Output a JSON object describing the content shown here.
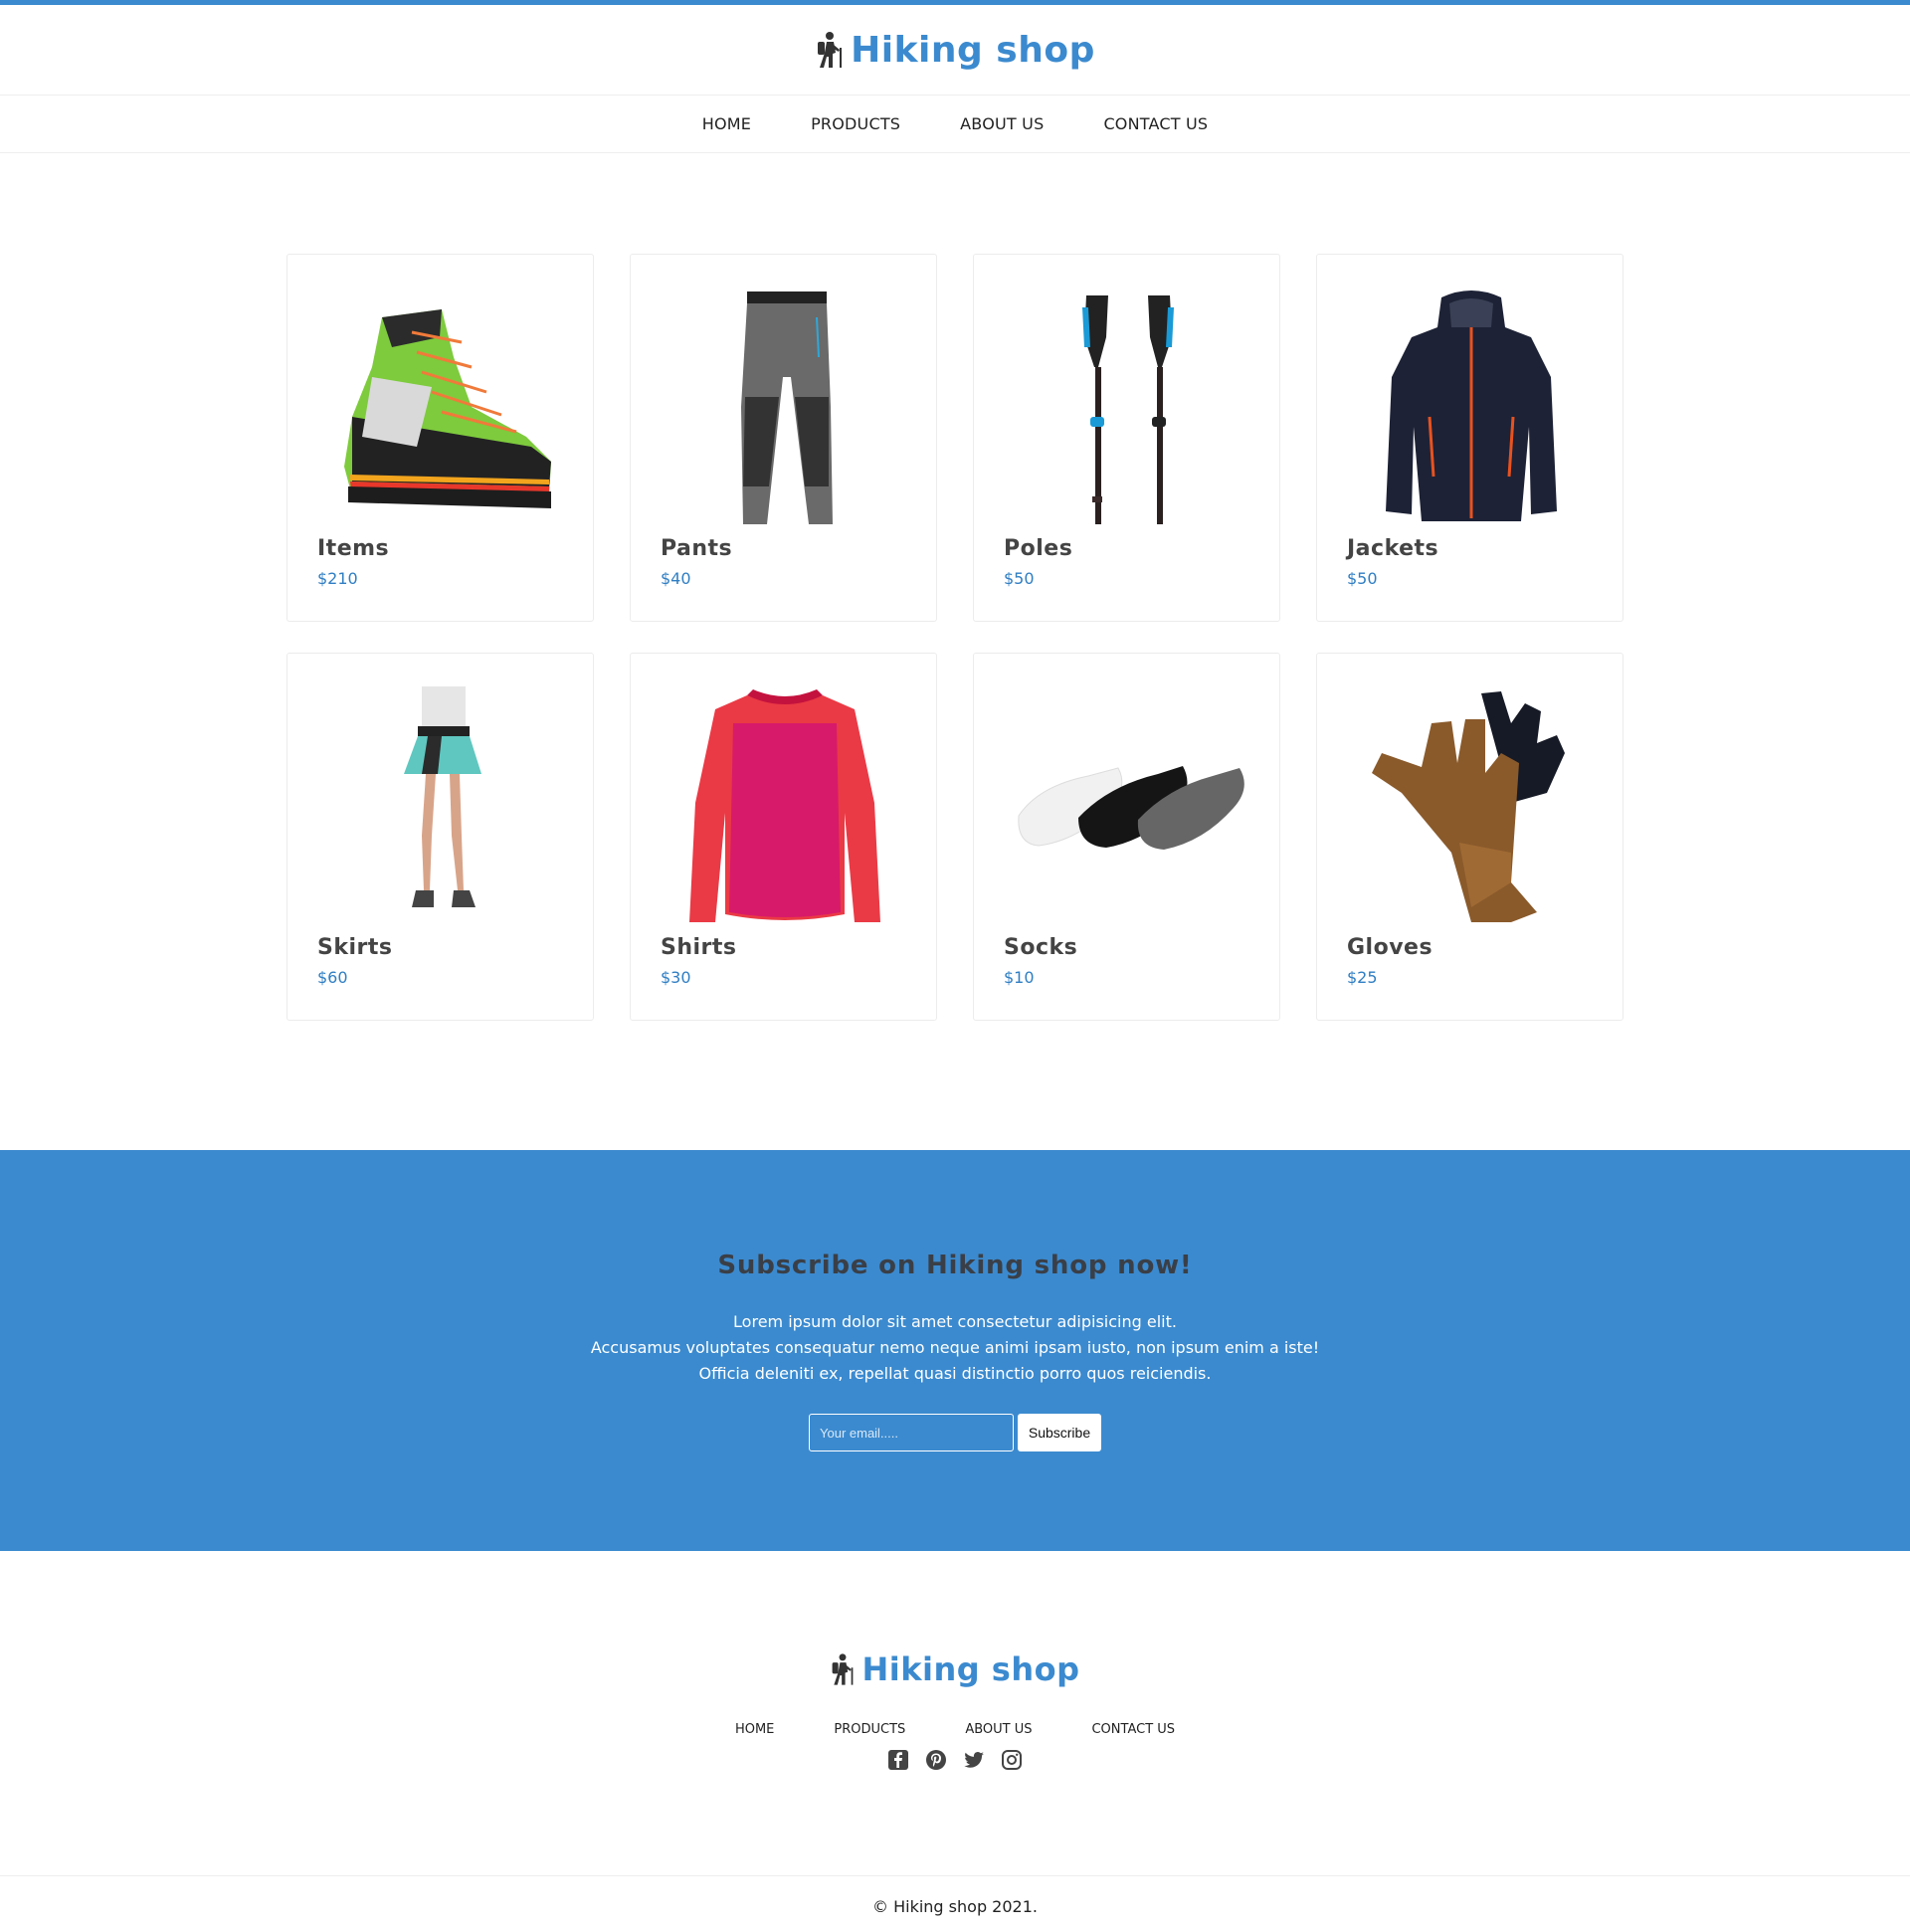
{
  "brand": {
    "name": "Hiking shop",
    "icon": "hiker-icon",
    "accent": "#3b8acf"
  },
  "nav": {
    "items": [
      "HOME",
      "PRODUCTS",
      "ABOUT US",
      "CONTACT US"
    ]
  },
  "products": [
    {
      "name": "Items",
      "price": "$210",
      "image": "hiking-boot-image"
    },
    {
      "name": "Pants",
      "price": "$40",
      "image": "pants-image"
    },
    {
      "name": "Poles",
      "price": "$50",
      "image": "trekking-poles-image"
    },
    {
      "name": "Jackets",
      "price": "$50",
      "image": "jacket-image"
    },
    {
      "name": "Skirts",
      "price": "$60",
      "image": "skirt-image"
    },
    {
      "name": "Shirts",
      "price": "$30",
      "image": "shirt-image"
    },
    {
      "name": "Socks",
      "price": "$10",
      "image": "socks-image"
    },
    {
      "name": "Gloves",
      "price": "$25",
      "image": "gloves-image"
    }
  ],
  "subscribe": {
    "title": "Subscribe on Hiking shop now!",
    "lines": [
      "Lorem ipsum dolor sit amet consectetur adipisicing elit.",
      "Accusamus voluptates consequatur nemo neque animi ipsam iusto, non ipsum enim a iste!",
      "Officia deleniti ex, repellat quasi distinctio porro quos reiciendis."
    ],
    "email_placeholder": "Your email.....",
    "button_label": "Subscribe"
  },
  "footer": {
    "nav": [
      "HOME",
      "PRODUCTS",
      "ABOUT US",
      "CONTACT US"
    ],
    "social": [
      "facebook-icon",
      "pinterest-icon",
      "twitter-icon",
      "instagram-icon"
    ],
    "copyright": "© Hiking shop 2021."
  }
}
